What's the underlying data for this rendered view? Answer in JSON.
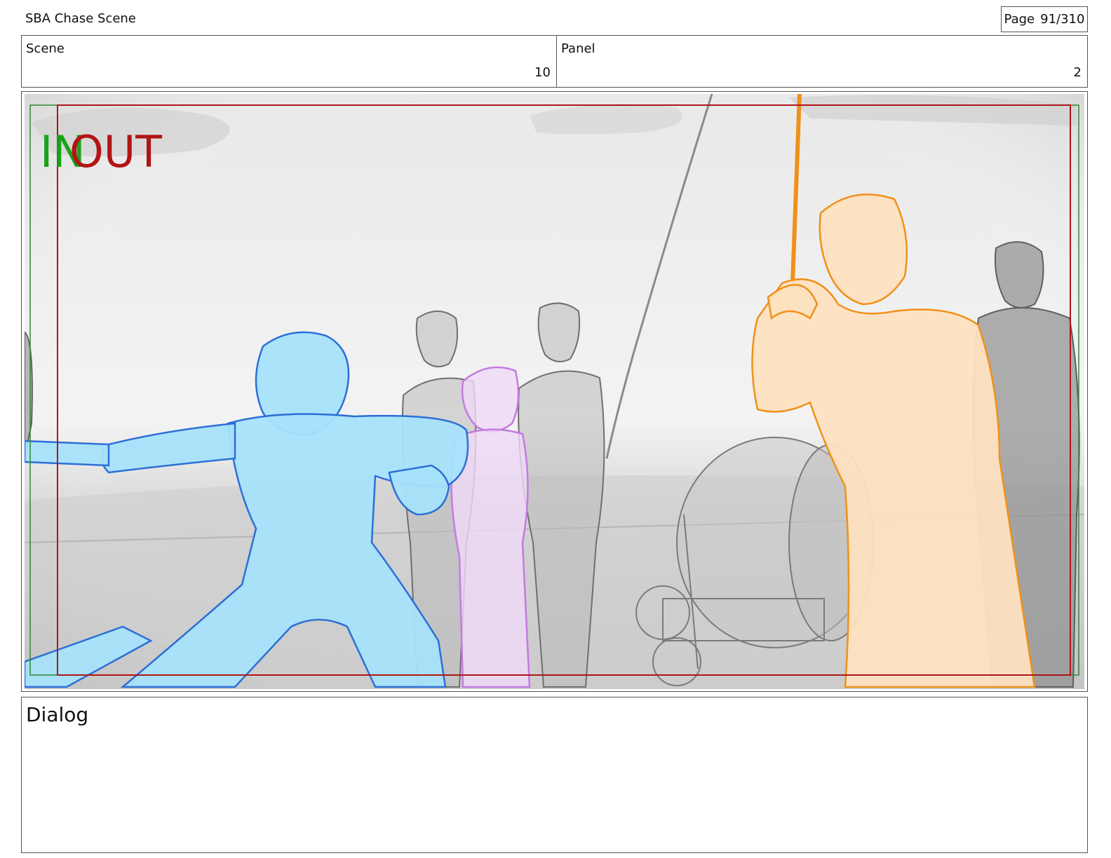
{
  "header": {
    "project_title": "SBA Chase Scene",
    "page_label": "Page",
    "page_value": "91/310"
  },
  "info": {
    "scene_label": "Scene",
    "scene_value": "10",
    "panel_label": "Panel",
    "panel_value": "2"
  },
  "frame": {
    "in_marker": "IN",
    "out_marker": "OUT",
    "in_color": "#1aa21a",
    "out_color": "#b01515"
  },
  "dialog": {
    "label": "Dialog"
  }
}
